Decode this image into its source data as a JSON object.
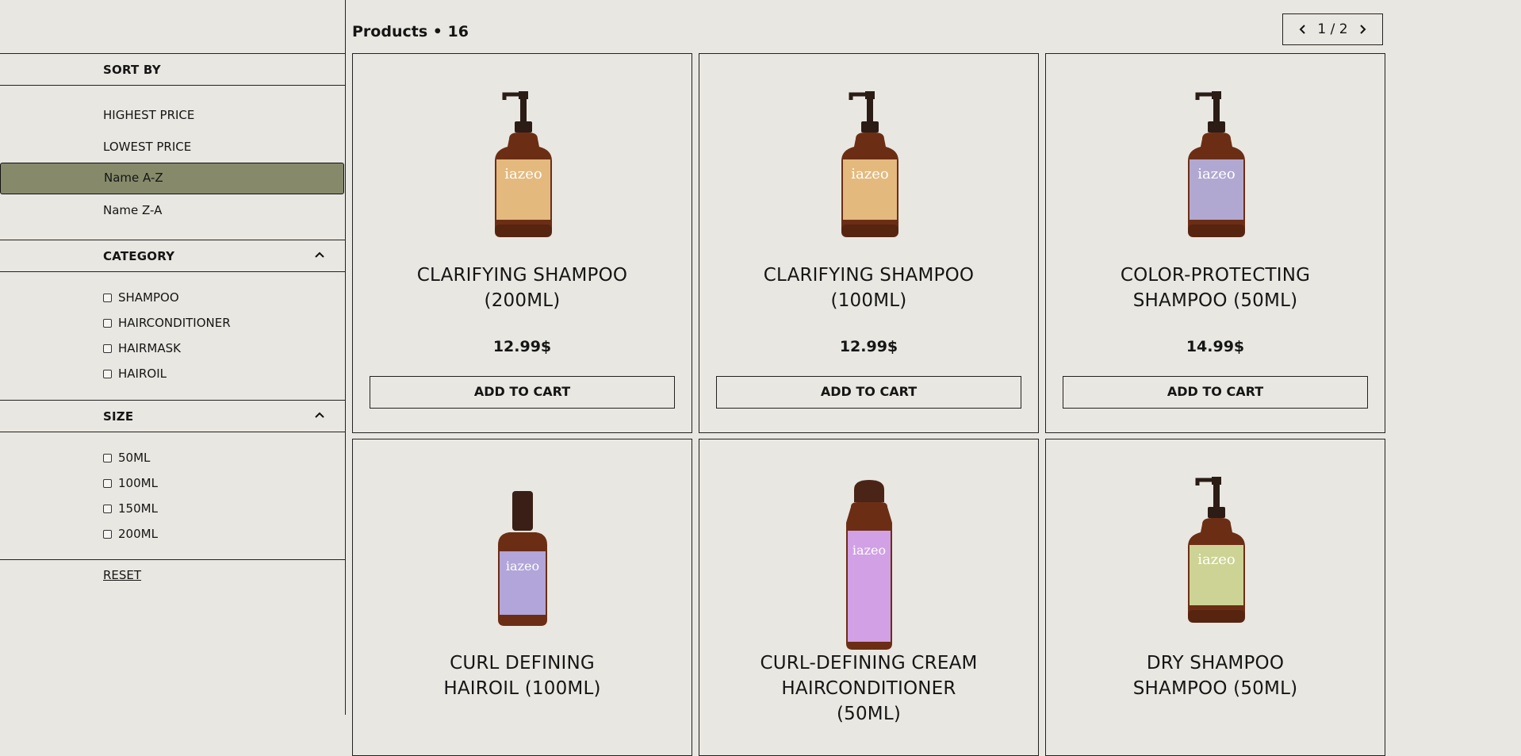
{
  "sidebar": {
    "sort": {
      "title": "SORT BY",
      "options": [
        "HIGHEST PRICE",
        "LOWEST PRICE",
        "Name A-Z",
        "Name Z-A"
      ],
      "selected": "Name A-Z"
    },
    "category": {
      "title": "CATEGORY",
      "options": [
        "SHAMPOO",
        "HAIRCONDITIONER",
        "HAIRMASK",
        "HAIROIL"
      ]
    },
    "size": {
      "title": "SIZE",
      "options": [
        "50ML",
        "100ML",
        "150ML",
        "200ML"
      ]
    },
    "reset_label": "RESET"
  },
  "header": {
    "title": "Products • 16"
  },
  "pager": {
    "label": "1 / 2"
  },
  "products": [
    {
      "name": "CLARIFYING SHAMPOO (200ML)",
      "price": "12.99$",
      "cart_label": "ADD TO CART",
      "label_color": "#f2c98a",
      "brand": "iazeo"
    },
    {
      "name": "CLARIFYING SHAMPOO (100ML)",
      "price": "12.99$",
      "cart_label": "ADD TO CART",
      "label_color": "#f2c98a",
      "brand": "iazeo"
    },
    {
      "name": "COLOR-PROTECTING SHAMPOO (50ML)",
      "price": "14.99$",
      "cart_label": "ADD TO CART",
      "label_color": "#b9b6e6",
      "brand": "iazeo"
    },
    {
      "name": "CURL DEFINING HAIROIL (100ML)",
      "price": "",
      "cart_label": "",
      "label_color": "#b9b3ee",
      "brand": "iazeo"
    },
    {
      "name": "CURL-DEFINING CREAM HAIRCONDITIONER (50ML)",
      "price": "",
      "cart_label": "",
      "label_color": "#d7a6f0",
      "brand": "iazeo"
    },
    {
      "name": "DRY SHAMPOO SHAMPOO (50ML)",
      "price": "",
      "cart_label": "",
      "label_color": "#d7e6a2",
      "brand": "iazeo"
    }
  ],
  "colors": {
    "background": "#e9e7e1",
    "selected_sort": "#868a6a",
    "border": "#222222",
    "bottle_glass": "#6b2e15"
  }
}
